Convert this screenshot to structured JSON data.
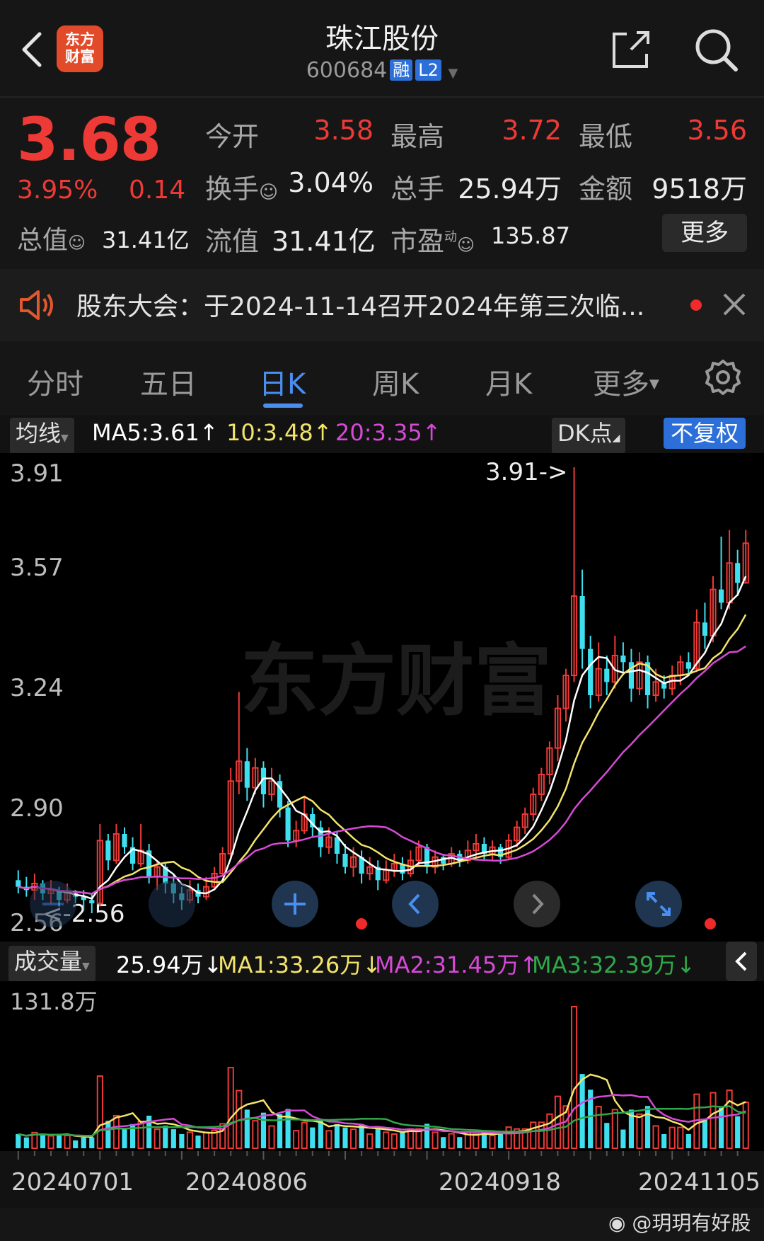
{
  "header": {
    "logo_text_1": "东方",
    "logo_text_2": "财富",
    "title": "珠江股份",
    "code": "600684",
    "badge_rong": "融",
    "badge_l2": "L2"
  },
  "quote": {
    "price": "3.68",
    "pct": "3.95%",
    "change": "0.14",
    "open_label": "今开",
    "open_value": "3.58",
    "high_label": "最高",
    "high_value": "3.72",
    "low_label": "最低",
    "low_value": "3.56",
    "turnover_label": "换手",
    "turnover_value": "3.04%",
    "volume_label": "总手",
    "volume_value": "25.94万",
    "amount_label": "金额",
    "amount_value": "9518万",
    "mktcap_label": "总值",
    "mktcap_value": "31.41亿",
    "float_label": "流值",
    "float_value": "31.41亿",
    "pe_label": "市盈",
    "pe_sup": "动",
    "pe_value": "135.87",
    "more_label": "更多"
  },
  "notice": {
    "text": "股东大会：于2024-11-14召开2024年第三次临..."
  },
  "tabs": [
    "分时",
    "五日",
    "日K",
    "周K",
    "月K",
    "更多"
  ],
  "chart_head": {
    "indicator": "均线",
    "ma5": "MA5:3.61",
    "ma10": "10:3.48",
    "ma20": "20:3.35",
    "dk_label": "DK点",
    "adjust_label": "不复权"
  },
  "kline_labels": {
    "y_top": "3.91",
    "y2": "3.57",
    "y3": "3.24",
    "y4": "2.90",
    "y_bottom": "2.56",
    "max_marker": "3.91->",
    "min_marker": "<-2.56",
    "watermark": "东方财富"
  },
  "vol_head": {
    "label": "成交量",
    "vol": "25.94万",
    "ma1": "MA1:33.26万",
    "ma2": "MA2:31.45万",
    "ma3": "MA3:32.39万",
    "y_top": "131.8万"
  },
  "dates": [
    "20240701",
    "20240806",
    "20240918",
    "20241105"
  ],
  "credit": "@玥玥有好股",
  "colors": {
    "up": "#ee3a36",
    "down": "#3ee0f0",
    "ma5": "#ffffff",
    "ma10": "#f2e46a",
    "ma20": "#d64ad6",
    "vol_ma3": "#2fa84a",
    "accent": "#4a8ef0"
  },
  "chart_data": {
    "type": "candlestick",
    "y_range": [
      2.56,
      3.91
    ],
    "period_start": "20240701",
    "period_end": "20241105",
    "price_points": [
      [
        2.66,
        2.64,
        2.69,
        2.62
      ],
      [
        2.64,
        2.63,
        2.67,
        2.61
      ],
      [
        2.63,
        2.65,
        2.68,
        2.6
      ],
      [
        2.65,
        2.62,
        2.66,
        2.6
      ],
      [
        2.62,
        2.63,
        2.66,
        2.59
      ],
      [
        2.63,
        2.6,
        2.64,
        2.58
      ],
      [
        2.6,
        2.62,
        2.65,
        2.59
      ],
      [
        2.62,
        2.61,
        2.63,
        2.59
      ],
      [
        2.61,
        2.6,
        2.63,
        2.57
      ],
      [
        2.6,
        2.59,
        2.62,
        2.56
      ],
      [
        2.59,
        2.78,
        2.83,
        2.58
      ],
      [
        2.78,
        2.72,
        2.8,
        2.69
      ],
      [
        2.72,
        2.8,
        2.83,
        2.71
      ],
      [
        2.8,
        2.76,
        2.82,
        2.74
      ],
      [
        2.76,
        2.71,
        2.79,
        2.69
      ],
      [
        2.71,
        2.75,
        2.83,
        2.7
      ],
      [
        2.75,
        2.67,
        2.77,
        2.65
      ],
      [
        2.67,
        2.7,
        2.72,
        2.63
      ],
      [
        2.7,
        2.65,
        2.71,
        2.62
      ],
      [
        2.65,
        2.62,
        2.68,
        2.59
      ],
      [
        2.62,
        2.6,
        2.64,
        2.57
      ],
      [
        2.6,
        2.63,
        2.66,
        2.59
      ],
      [
        2.63,
        2.61,
        2.65,
        2.59
      ],
      [
        2.61,
        2.64,
        2.67,
        2.6
      ],
      [
        2.64,
        2.68,
        2.7,
        2.63
      ],
      [
        2.68,
        2.74,
        2.76,
        2.67
      ],
      [
        2.74,
        2.96,
        3.0,
        2.73
      ],
      [
        2.96,
        3.02,
        3.23,
        2.92
      ],
      [
        3.02,
        2.94,
        3.06,
        2.9
      ],
      [
        2.94,
        3.0,
        3.03,
        2.92
      ],
      [
        3.0,
        2.92,
        3.02,
        2.88
      ],
      [
        2.92,
        2.96,
        3.0,
        2.9
      ],
      [
        2.96,
        2.88,
        2.98,
        2.85
      ],
      [
        2.88,
        2.78,
        2.9,
        2.76
      ],
      [
        2.78,
        2.81,
        2.84,
        2.76
      ],
      [
        2.81,
        2.86,
        2.91,
        2.8
      ],
      [
        2.86,
        2.82,
        2.88,
        2.79
      ],
      [
        2.82,
        2.76,
        2.84,
        2.73
      ],
      [
        2.76,
        2.79,
        2.82,
        2.74
      ],
      [
        2.79,
        2.74,
        2.81,
        2.71
      ],
      [
        2.74,
        2.7,
        2.77,
        2.68
      ],
      [
        2.7,
        2.73,
        2.76,
        2.67
      ],
      [
        2.73,
        2.68,
        2.75,
        2.65
      ],
      [
        2.68,
        2.7,
        2.73,
        2.66
      ],
      [
        2.7,
        2.66,
        2.72,
        2.63
      ],
      [
        2.66,
        2.69,
        2.72,
        2.65
      ],
      [
        2.69,
        2.71,
        2.74,
        2.67
      ],
      [
        2.71,
        2.68,
        2.73,
        2.66
      ],
      [
        2.68,
        2.72,
        2.75,
        2.67
      ],
      [
        2.72,
        2.76,
        2.78,
        2.7
      ],
      [
        2.76,
        2.7,
        2.77,
        2.68
      ],
      [
        2.7,
        2.73,
        2.75,
        2.68
      ],
      [
        2.73,
        2.71,
        2.74,
        2.69
      ],
      [
        2.71,
        2.74,
        2.76,
        2.7
      ],
      [
        2.74,
        2.72,
        2.75,
        2.7
      ],
      [
        2.72,
        2.75,
        2.78,
        2.71
      ],
      [
        2.75,
        2.77,
        2.8,
        2.73
      ],
      [
        2.77,
        2.74,
        2.79,
        2.72
      ],
      [
        2.74,
        2.76,
        2.78,
        2.72
      ],
      [
        2.76,
        2.73,
        2.77,
        2.71
      ],
      [
        2.73,
        2.78,
        2.8,
        2.72
      ],
      [
        2.78,
        2.82,
        2.84,
        2.76
      ],
      [
        2.82,
        2.86,
        2.88,
        2.8
      ],
      [
        2.86,
        2.92,
        2.94,
        2.84
      ],
      [
        2.92,
        2.98,
        3.0,
        2.9
      ],
      [
        2.98,
        3.06,
        3.08,
        2.95
      ],
      [
        3.06,
        3.18,
        3.22,
        3.02
      ],
      [
        3.18,
        3.28,
        3.3,
        3.14
      ],
      [
        3.28,
        3.52,
        3.91,
        3.26
      ],
      [
        3.52,
        3.36,
        3.6,
        3.3
      ],
      [
        3.36,
        3.22,
        3.4,
        3.18
      ],
      [
        3.22,
        3.3,
        3.38,
        3.2
      ],
      [
        3.3,
        3.26,
        3.34,
        3.22
      ],
      [
        3.26,
        3.34,
        3.4,
        3.24
      ],
      [
        3.34,
        3.32,
        3.38,
        3.28
      ],
      [
        3.32,
        3.24,
        3.36,
        3.2
      ],
      [
        3.24,
        3.32,
        3.35,
        3.22
      ],
      [
        3.32,
        3.22,
        3.34,
        3.18
      ],
      [
        3.22,
        3.26,
        3.3,
        3.2
      ],
      [
        3.26,
        3.24,
        3.28,
        3.21
      ],
      [
        3.24,
        3.28,
        3.31,
        3.22
      ],
      [
        3.28,
        3.32,
        3.34,
        3.25
      ],
      [
        3.32,
        3.3,
        3.35,
        3.28
      ],
      [
        3.3,
        3.44,
        3.48,
        3.29
      ],
      [
        3.44,
        3.4,
        3.5,
        3.36
      ],
      [
        3.4,
        3.54,
        3.58,
        3.38
      ],
      [
        3.54,
        3.5,
        3.7,
        3.48
      ],
      [
        3.5,
        3.62,
        3.72,
        3.48
      ],
      [
        3.62,
        3.56,
        3.66,
        3.52
      ],
      [
        3.56,
        3.68,
        3.72,
        3.56
      ]
    ]
  }
}
